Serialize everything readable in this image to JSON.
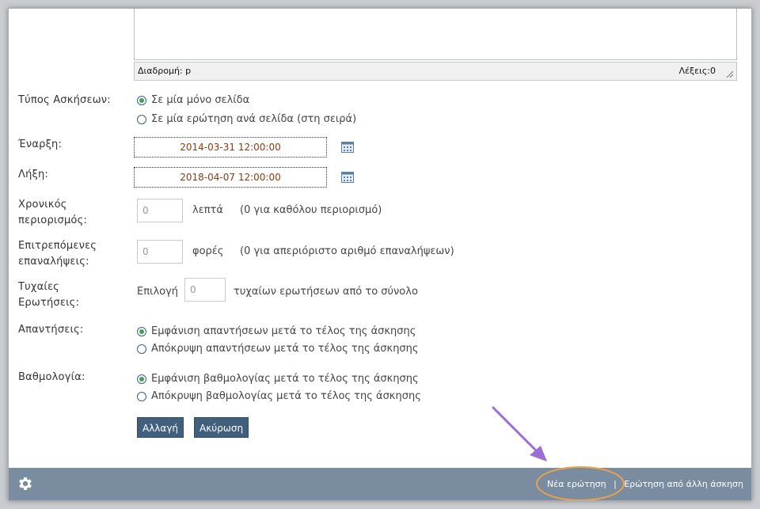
{
  "editor": {
    "path_label": "Διαδρομή: p",
    "word_count": "Λέξεις:0"
  },
  "form": {
    "exercise_type": {
      "label": "Τύπος Ασκήσεων:",
      "options": [
        "Σε μία μόνο σελίδα",
        "Σε μία ερώτηση ανά σελίδα (στη σειρά)"
      ],
      "selected_index": 0
    },
    "start": {
      "label": "Έναρξη:",
      "value": "2014-03-31 12:00:00"
    },
    "end": {
      "label": "Λήξη:",
      "value": "2018-04-07 12:00:00"
    },
    "time_limit": {
      "label_line1": "Χρονικός",
      "label_line2": "περιορισμός:",
      "value": "0",
      "unit": "λεπτά",
      "hint": "(0 για καθόλου περιορισμό)"
    },
    "attempts": {
      "label_line1": "Επιτρεπόμενες",
      "label_line2": "επαναλήψεις:",
      "value": "0",
      "unit": "φορές",
      "hint": "(0 για απεριόριστο αριθμό επαναλήψεων)"
    },
    "random_questions": {
      "label_line1": "Τυχαίες",
      "label_line2": "Ερωτήσεις:",
      "prefix": "Επιλογή",
      "value": "0",
      "suffix": "τυχαίων ερωτήσεων από το σύνολο"
    },
    "answers": {
      "label": "Απαντήσεις:",
      "options": [
        "Εμφάνιση απαντήσεων μετά το τέλος της άσκησης",
        "Απόκρυψη απαντήσεων μετά το τέλος της άσκησης"
      ],
      "selected_index": 0
    },
    "grading": {
      "label": "Βαθμολογία:",
      "options": [
        "Εμφάνιση βαθμολογίας μετά το τέλος της άσκησης",
        "Απόκρυψη βαθμολογίας μετά το τέλος της άσκησης"
      ],
      "selected_index": 0
    },
    "buttons": {
      "change": "Αλλαγή",
      "cancel": "Ακύρωση"
    }
  },
  "footer": {
    "new_question": "Νέα ερώτηση",
    "separator": "|",
    "from_other_exercise": "Ερώτηση από άλλη άσκηση",
    "icon": "gear-icon",
    "bg_color": "#7a8ca0"
  },
  "annotation": {
    "arrow_color": "#9b6fd6",
    "ellipse_color": "#f0a24a"
  }
}
